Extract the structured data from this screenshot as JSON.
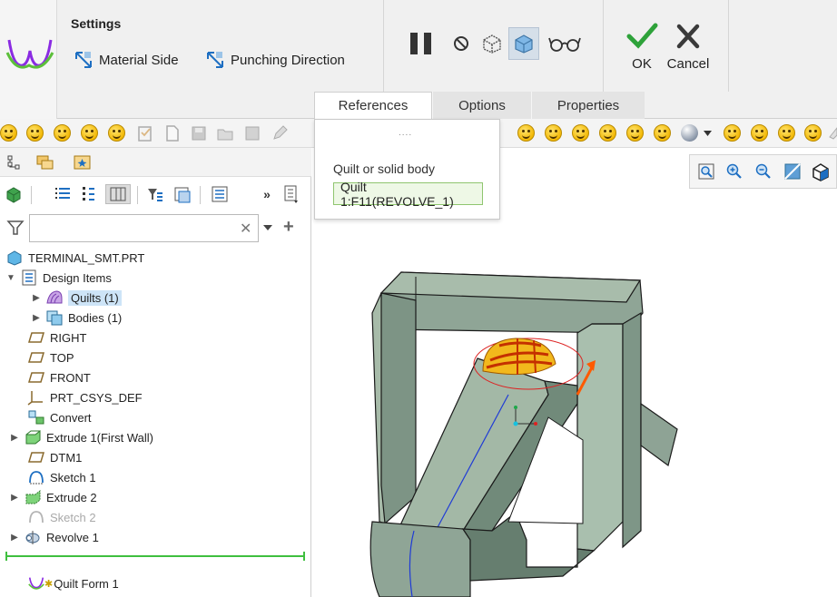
{
  "ribbon": {
    "settings_title": "Settings",
    "material_side_label": "Material Side",
    "punching_direction_label": "Punching Direction",
    "ok_label": "OK",
    "cancel_label": "Cancel",
    "tabs": [
      {
        "label": "References",
        "active": true
      },
      {
        "label": "Options",
        "active": false
      },
      {
        "label": "Properties",
        "active": false
      }
    ],
    "accent_color": "#2ea23a",
    "cancel_color": "#3a3a3a"
  },
  "references_panel": {
    "grip": "....",
    "label": "Quilt or solid body",
    "value": "Quilt 1:F11(REVOLVE_1)"
  },
  "left_panel": {
    "search": {
      "placeholder": "",
      "value": ""
    },
    "tree": [
      {
        "label": "TERMINAL_SMT.PRT",
        "icon": "part-icon"
      },
      {
        "label": "Design Items",
        "icon": "design-items-icon",
        "expanded": true
      },
      {
        "label": "Quilts (1)",
        "icon": "quilt-icon",
        "selected": true
      },
      {
        "label": "Bodies (1)",
        "icon": "bodies-icon"
      },
      {
        "label": "RIGHT",
        "icon": "datum-plane-icon"
      },
      {
        "label": "TOP",
        "icon": "datum-plane-icon"
      },
      {
        "label": "FRONT",
        "icon": "datum-plane-icon"
      },
      {
        "label": "PRT_CSYS_DEF",
        "icon": "csys-icon"
      },
      {
        "label": "Convert",
        "icon": "convert-icon"
      },
      {
        "label": "Extrude 1(First Wall)",
        "icon": "extrude-icon"
      },
      {
        "label": "DTM1",
        "icon": "datum-plane-icon"
      },
      {
        "label": "Sketch 1",
        "icon": "sketch-icon"
      },
      {
        "label": "Extrude 2",
        "icon": "extrude-icon"
      },
      {
        "label": "Sketch 2",
        "icon": "sketch-icon",
        "dimmed": true
      },
      {
        "label": "Revolve 1",
        "icon": "revolve-icon"
      },
      {
        "label": "Quilt Form 1",
        "icon": "quilt-form-icon"
      }
    ]
  }
}
